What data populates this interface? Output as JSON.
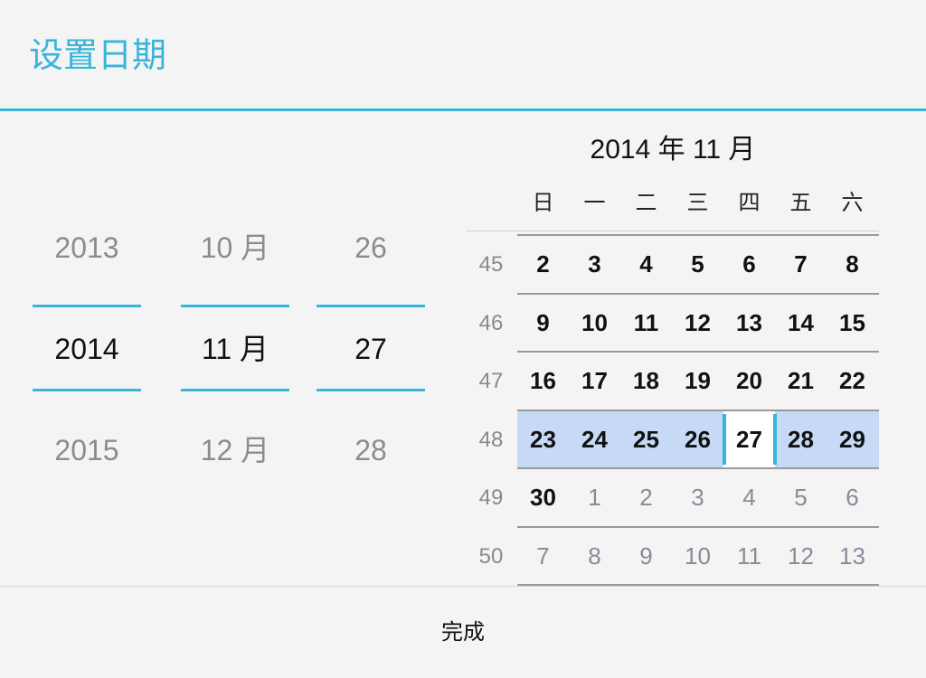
{
  "dialog": {
    "title": "设置日期",
    "done_label": "完成"
  },
  "colors": {
    "accent": "#39b4db",
    "week_highlight": "#c6daf6",
    "spinner_dim": "#8c8c8c"
  },
  "spinners": [
    {
      "id": "year",
      "prev": "2013",
      "current": "2014",
      "next": "2015"
    },
    {
      "id": "month",
      "prev": "10 月",
      "current": "11 月",
      "next": "12 月"
    },
    {
      "id": "day",
      "prev": "26",
      "current": "27",
      "next": "28"
    }
  ],
  "calendar": {
    "header": "2014 年 11 月",
    "weekdays": [
      "日",
      "一",
      "二",
      "三",
      "四",
      "五",
      "六"
    ],
    "selected_day": "27",
    "weeks": [
      {
        "num": "45",
        "days": [
          [
            "2",
            0
          ],
          [
            "3",
            0
          ],
          [
            "4",
            0
          ],
          [
            "5",
            0
          ],
          [
            "6",
            0
          ],
          [
            "7",
            0
          ],
          [
            "8",
            0
          ]
        ]
      },
      {
        "num": "46",
        "days": [
          [
            "9",
            0
          ],
          [
            "10",
            0
          ],
          [
            "11",
            0
          ],
          [
            "12",
            0
          ],
          [
            "13",
            0
          ],
          [
            "14",
            0
          ],
          [
            "15",
            0
          ]
        ]
      },
      {
        "num": "47",
        "days": [
          [
            "16",
            0
          ],
          [
            "17",
            0
          ],
          [
            "18",
            0
          ],
          [
            "19",
            0
          ],
          [
            "20",
            0
          ],
          [
            "21",
            0
          ],
          [
            "22",
            0
          ]
        ]
      },
      {
        "num": "48",
        "days": [
          [
            "23",
            0
          ],
          [
            "24",
            0
          ],
          [
            "25",
            0
          ],
          [
            "26",
            0
          ],
          [
            "27",
            0
          ],
          [
            "28",
            0
          ],
          [
            "29",
            0
          ]
        ]
      },
      {
        "num": "49",
        "days": [
          [
            "30",
            0
          ],
          [
            "1",
            1
          ],
          [
            "2",
            1
          ],
          [
            "3",
            1
          ],
          [
            "4",
            1
          ],
          [
            "5",
            1
          ],
          [
            "6",
            1
          ]
        ]
      },
      {
        "num": "50",
        "days": [
          [
            "7",
            1
          ],
          [
            "8",
            1
          ],
          [
            "9",
            1
          ],
          [
            "10",
            1
          ],
          [
            "11",
            1
          ],
          [
            "12",
            1
          ],
          [
            "13",
            1
          ]
        ]
      }
    ]
  }
}
